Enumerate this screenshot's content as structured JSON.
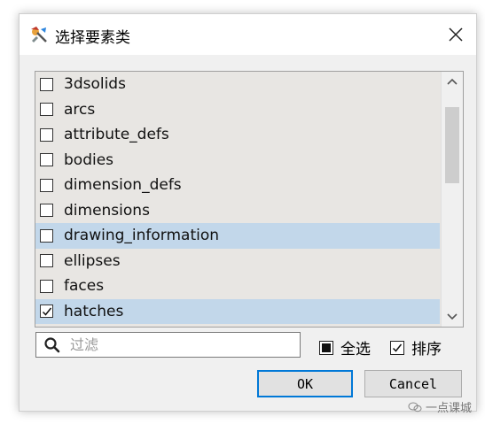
{
  "window": {
    "title": "选择要素类",
    "close_icon": "close-icon"
  },
  "list": {
    "items": [
      {
        "label": "3dsolids",
        "checked": false,
        "highlighted": false
      },
      {
        "label": "arcs",
        "checked": false,
        "highlighted": false
      },
      {
        "label": "attribute_defs",
        "checked": false,
        "highlighted": false
      },
      {
        "label": "bodies",
        "checked": false,
        "highlighted": false
      },
      {
        "label": "dimension_defs",
        "checked": false,
        "highlighted": false
      },
      {
        "label": "dimensions",
        "checked": false,
        "highlighted": false
      },
      {
        "label": "drawing_information",
        "checked": false,
        "highlighted": true
      },
      {
        "label": "ellipses",
        "checked": false,
        "highlighted": false
      },
      {
        "label": "faces",
        "checked": false,
        "highlighted": false
      },
      {
        "label": "hatches",
        "checked": true,
        "highlighted": true
      }
    ]
  },
  "search": {
    "placeholder": "过滤",
    "value": "",
    "icon": "search-icon"
  },
  "options": {
    "select_all_label": "全选",
    "select_all_state": "partial",
    "sort_label": "排序",
    "sort_checked": true
  },
  "buttons": {
    "ok_label": "OK",
    "cancel_label": "Cancel"
  },
  "watermark": {
    "text": "一点课城"
  },
  "colors": {
    "highlight": "#c2d7ea",
    "list_bg": "#e8e6e3",
    "accent": "#0078d7"
  }
}
